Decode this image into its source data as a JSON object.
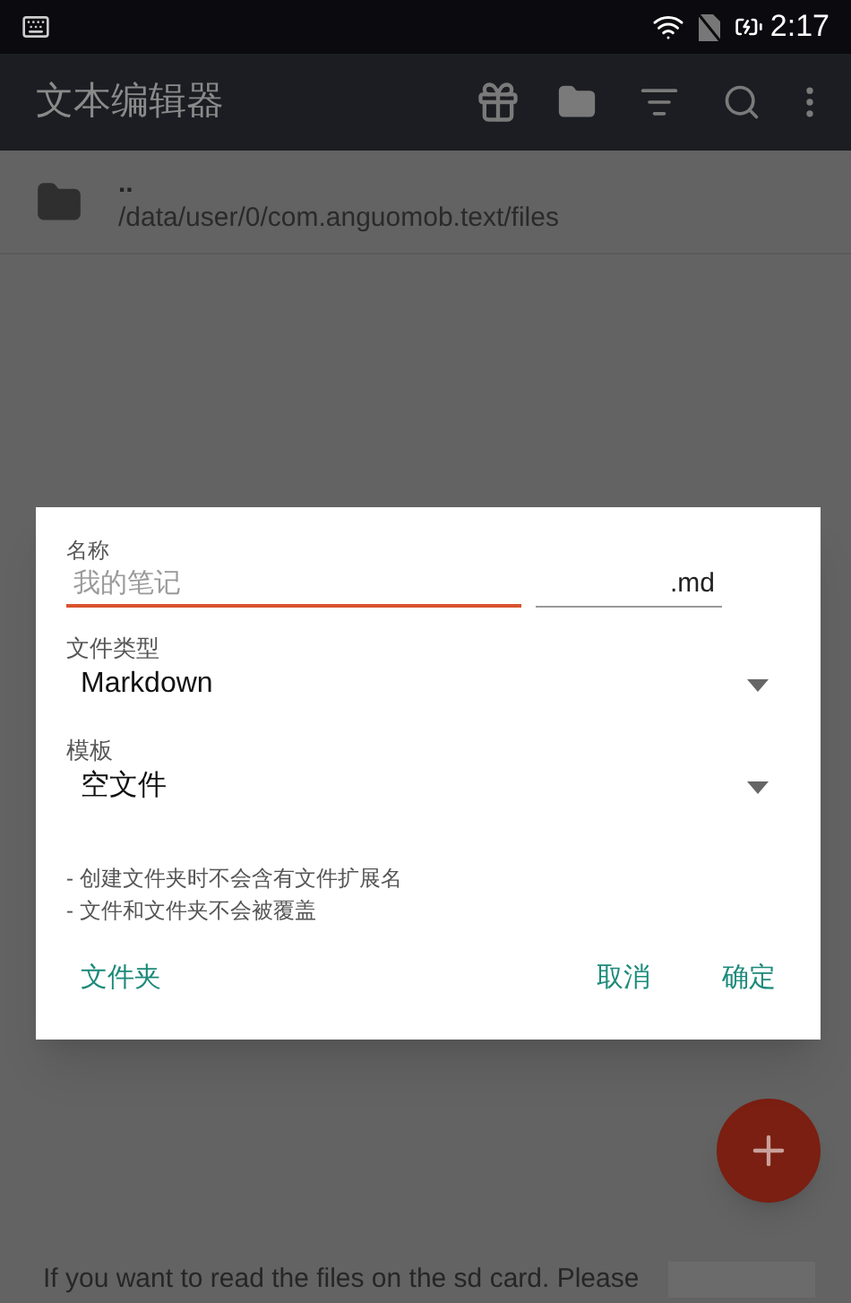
{
  "status_bar": {
    "time": "2:17"
  },
  "toolbar": {
    "title": "文本编辑器"
  },
  "file_list": [
    {
      "name": "..",
      "path": "/data/user/0/com.anguomob.text/files"
    }
  ],
  "dialog": {
    "name_label": "名称",
    "name_placeholder": "我的笔记",
    "extension": ".md",
    "selects": [
      {
        "label": "文件类型",
        "value": "Markdown"
      },
      {
        "label": "模板",
        "value": "空文件"
      }
    ],
    "notes": [
      "- 创建文件夹时不会含有文件扩展名",
      "- 文件和文件夹不会被覆盖"
    ],
    "buttons": [
      {
        "label": "文件夹",
        "kind": "left"
      },
      {
        "label": "取消",
        "kind": "right"
      },
      {
        "label": "确定",
        "kind": "right"
      }
    ]
  },
  "footer_text": "If you want to read the files on the sd card. Please"
}
